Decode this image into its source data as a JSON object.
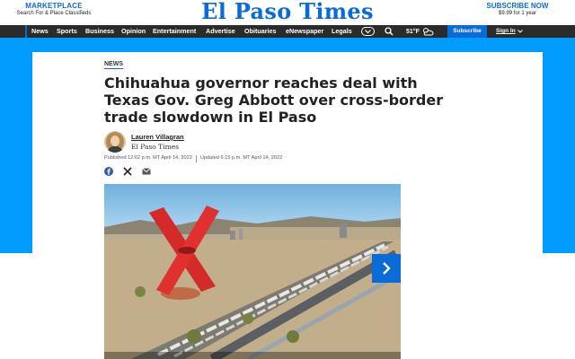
{
  "masthead": {
    "marketplace_title": "MARKETPLACE",
    "marketplace_sub": "Search For & Place Classifieds",
    "logo": "El Paso Times",
    "subscribe_title": "SUBSCRIBE NOW",
    "subscribe_price": "$9.99 for 1 year"
  },
  "nav": {
    "items": [
      "News",
      "Sports",
      "Business",
      "Opinion",
      "Entertainment",
      "Advertise",
      "Obituaries",
      "eNewspaper",
      "Legals"
    ],
    "temperature": "51°F",
    "subscribe_label": "Subscribe",
    "signin_label": "Sign In"
  },
  "article": {
    "section": "NEWS",
    "headline": "Chihuahua governor reaches deal with Texas Gov. Greg Abbott over cross-border trade slowdown in El Paso",
    "author": "Lauren Villagran",
    "publication": "El Paso Times",
    "published": "Published 12:02 p.m. MT April 14, 2022",
    "updated": "Updated 6:15 p.m. MT April 14, 2022"
  },
  "share": {
    "icons": [
      "facebook-icon",
      "x-icon",
      "email-icon"
    ]
  },
  "colors": {
    "brand_blue": "#0a6bd6",
    "background_blue": "#009bff",
    "nav_dark": "#2b2b2b"
  }
}
